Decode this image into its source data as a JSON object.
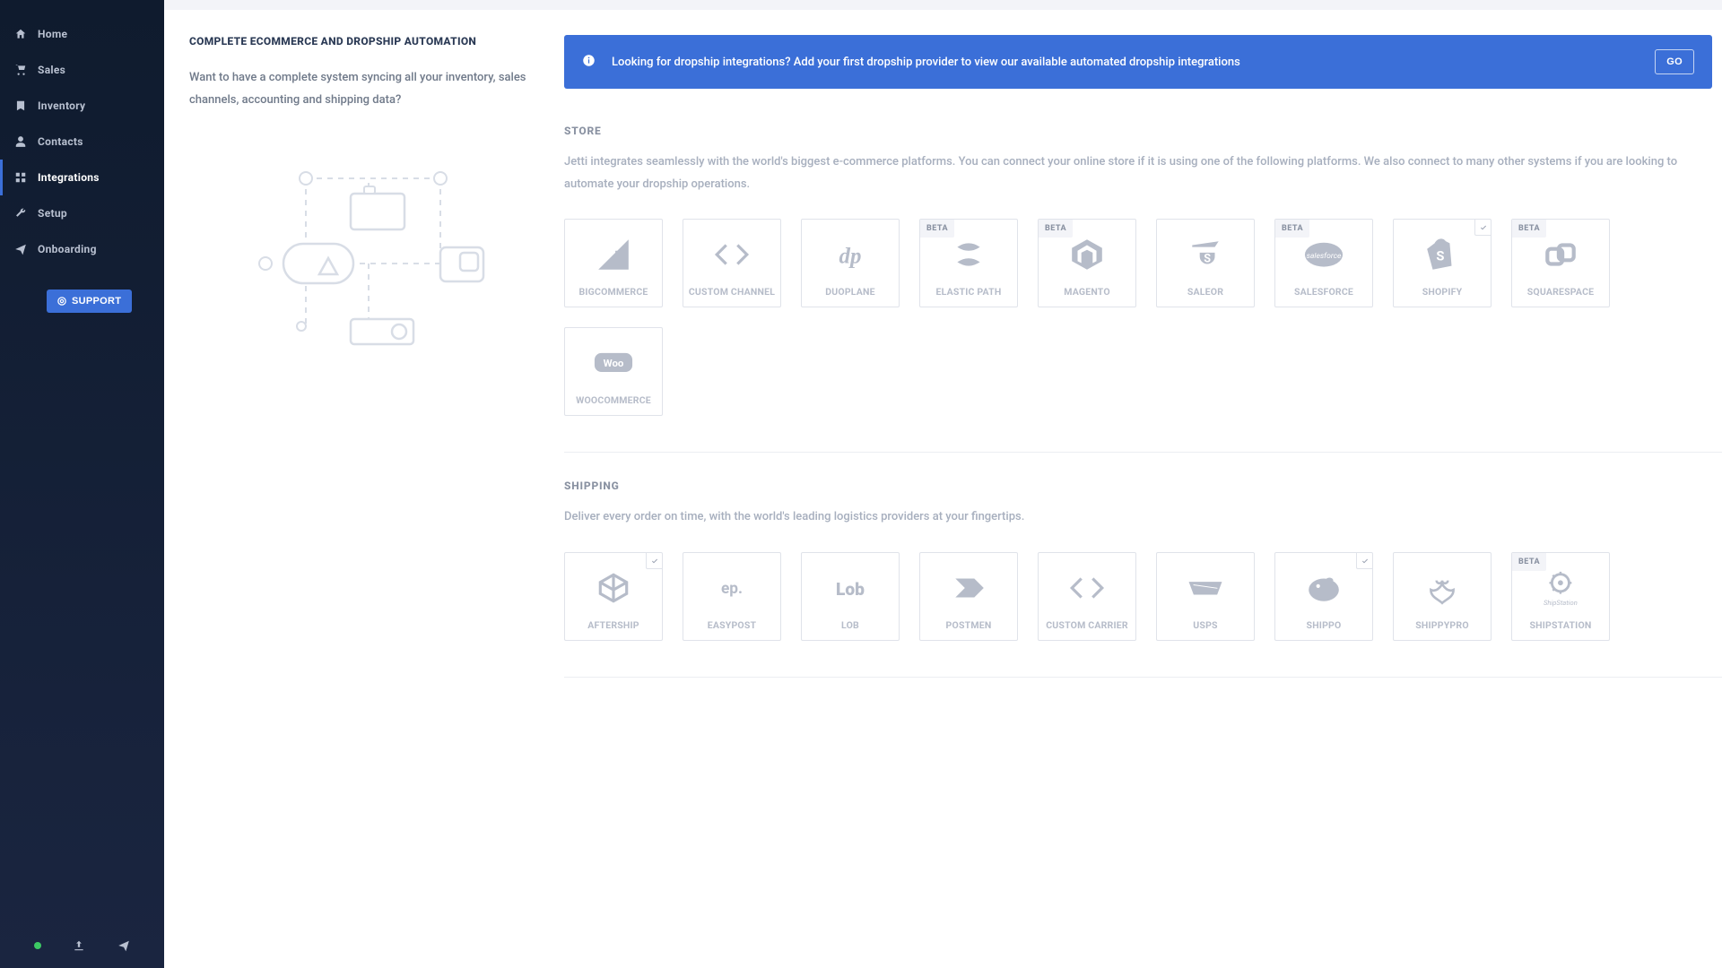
{
  "sidebar": {
    "items": [
      {
        "label": "Home",
        "icon": "home"
      },
      {
        "label": "Sales",
        "icon": "cart"
      },
      {
        "label": "Inventory",
        "icon": "bookmark"
      },
      {
        "label": "Contacts",
        "icon": "user"
      },
      {
        "label": "Integrations",
        "icon": "grid",
        "active": true
      },
      {
        "label": "Setup",
        "icon": "wrench"
      },
      {
        "label": "Onboarding",
        "icon": "send"
      }
    ],
    "support_label": "SUPPORT"
  },
  "left_panel": {
    "title": "COMPLETE ECOMMERCE AND DROPSHIP AUTOMATION",
    "description": "Want to have a complete system syncing all your inventory, sales channels, accounting and shipping data?"
  },
  "banner": {
    "text": "Looking for dropship integrations? Add your first dropship provider to view our available automated dropship integrations",
    "button": "GO"
  },
  "groups": [
    {
      "key": "store",
      "title": "STORE",
      "description": "Jetti integrates seamlessly with the world's biggest e-commerce platforms. You can connect your online store if it is using one of the following platforms. We also connect to many other systems if you are looking to automate your dropship operations.",
      "cards": [
        {
          "label": "BIGCOMMERCE",
          "icon": "bigcommerce"
        },
        {
          "label": "CUSTOM CHANNEL",
          "icon": "code"
        },
        {
          "label": "DUOPLANE",
          "icon": "duoplane"
        },
        {
          "label": "ELASTIC PATH",
          "icon": "elasticpath",
          "badge": "BETA"
        },
        {
          "label": "MAGENTO",
          "icon": "magento",
          "badge": "BETA"
        },
        {
          "label": "SALEOR",
          "icon": "saleor"
        },
        {
          "label": "SALESFORCE",
          "icon": "salesforce",
          "badge": "BETA"
        },
        {
          "label": "SHOPIFY",
          "icon": "shopify",
          "check": true
        },
        {
          "label": "SQUARESPACE",
          "icon": "squarespace",
          "badge": "BETA"
        },
        {
          "label": "WOOCOMMERCE",
          "icon": "woo"
        }
      ]
    },
    {
      "key": "shipping",
      "title": "SHIPPING",
      "description": "Deliver every order on time, with the world's leading logistics providers at your fingertips.",
      "cards": [
        {
          "label": "AFTERSHIP",
          "icon": "box",
          "check": true
        },
        {
          "label": "EASYPOST",
          "icon": "easypost"
        },
        {
          "label": "LOB",
          "icon": "lob"
        },
        {
          "label": "POSTMEN",
          "icon": "postmen"
        },
        {
          "label": "CUSTOM CARRIER",
          "icon": "code"
        },
        {
          "label": "USPS",
          "icon": "usps"
        },
        {
          "label": "SHIPPO",
          "icon": "shippo",
          "check": true
        },
        {
          "label": "SHIPPYPRO",
          "icon": "shippypro"
        },
        {
          "label": "SHIPSTATION",
          "icon": "shipstation",
          "badge": "BETA"
        }
      ]
    }
  ]
}
